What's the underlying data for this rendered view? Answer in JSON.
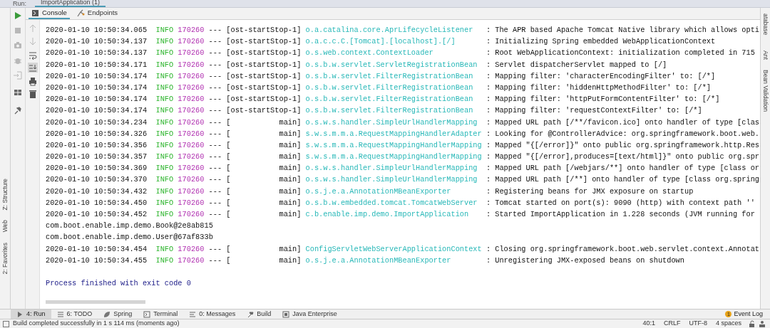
{
  "run_tab_bar": {
    "label": "Run:",
    "tab": "ImportApplication (1)"
  },
  "console_tabs": [
    {
      "label": "Console",
      "kind": "console",
      "selected": true
    },
    {
      "label": "Endpoints",
      "kind": "endpoints",
      "selected": false
    }
  ],
  "left_tool_strip": [
    {
      "label": "Z: Structure",
      "kind": "structure"
    },
    {
      "label": "Web",
      "kind": "web"
    },
    {
      "label": "2: Favorites",
      "kind": "favorites"
    }
  ],
  "right_tool_strip": [
    {
      "label": "atabase",
      "kind": "database"
    },
    {
      "label": "Ant",
      "kind": "ant"
    },
    {
      "label": "Bean Validation",
      "kind": "bean"
    }
  ],
  "log_lines": [
    {
      "kind": "log",
      "time": "2020-01-10 10:50:34.065",
      "level": "INFO",
      "pid": "170260",
      "thread": "--- [ost-startStop-1]",
      "logger": "o.a.catalina.core.AprLifecycleListener",
      "message": ": The APR based Apache Tomcat Native library which allows opti"
    },
    {
      "kind": "log",
      "time": "2020-01-10 10:50:34.137",
      "level": "INFO",
      "pid": "170260",
      "thread": "--- [ost-startStop-1]",
      "logger": "o.a.c.c.C.[Tomcat].[localhost].[/]",
      "message": ": Initializing Spring embedded WebApplicationContext"
    },
    {
      "kind": "log",
      "time": "2020-01-10 10:50:34.137",
      "level": "INFO",
      "pid": "170260",
      "thread": "--- [ost-startStop-1]",
      "logger": "o.s.web.context.ContextLoader",
      "message": ": Root WebApplicationContext: initialization completed in 715"
    },
    {
      "kind": "log",
      "time": "2020-01-10 10:50:34.171",
      "level": "INFO",
      "pid": "170260",
      "thread": "--- [ost-startStop-1]",
      "logger": "o.s.b.w.servlet.ServletRegistrationBean",
      "message": ": Servlet dispatcherServlet mapped to [/]"
    },
    {
      "kind": "log",
      "time": "2020-01-10 10:50:34.174",
      "level": "INFO",
      "pid": "170260",
      "thread": "--- [ost-startStop-1]",
      "logger": "o.s.b.w.servlet.FilterRegistrationBean",
      "message": ": Mapping filter: 'characterEncodingFilter' to: [/*]"
    },
    {
      "kind": "log",
      "time": "2020-01-10 10:50:34.174",
      "level": "INFO",
      "pid": "170260",
      "thread": "--- [ost-startStop-1]",
      "logger": "o.s.b.w.servlet.FilterRegistrationBean",
      "message": ": Mapping filter: 'hiddenHttpMethodFilter' to: [/*]"
    },
    {
      "kind": "log",
      "time": "2020-01-10 10:50:34.174",
      "level": "INFO",
      "pid": "170260",
      "thread": "--- [ost-startStop-1]",
      "logger": "o.s.b.w.servlet.FilterRegistrationBean",
      "message": ": Mapping filter: 'httpPutFormContentFilter' to: [/*]"
    },
    {
      "kind": "log",
      "time": "2020-01-10 10:50:34.174",
      "level": "INFO",
      "pid": "170260",
      "thread": "--- [ost-startStop-1]",
      "logger": "o.s.b.w.servlet.FilterRegistrationBean",
      "message": ": Mapping filter: 'requestContextFilter' to: [/*]"
    },
    {
      "kind": "log",
      "time": "2020-01-10 10:50:34.234",
      "level": "INFO",
      "pid": "170260",
      "thread": "--- [           main]",
      "logger": "o.s.w.s.handler.SimpleUrlHandlerMapping",
      "message": ": Mapped URL path [/**/favicon.ico] onto handler of type [clas"
    },
    {
      "kind": "log",
      "time": "2020-01-10 10:50:34.326",
      "level": "INFO",
      "pid": "170260",
      "thread": "--- [           main]",
      "logger": "s.w.s.m.m.a.RequestMappingHandlerAdapter",
      "message": ": Looking for @ControllerAdvice: org.springframework.boot.web."
    },
    {
      "kind": "log",
      "time": "2020-01-10 10:50:34.356",
      "level": "INFO",
      "pid": "170260",
      "thread": "--- [           main]",
      "logger": "s.w.s.m.m.a.RequestMappingHandlerMapping",
      "message": ": Mapped \"{[/error]}\" onto public org.springframework.http.Res"
    },
    {
      "kind": "log",
      "time": "2020-01-10 10:50:34.357",
      "level": "INFO",
      "pid": "170260",
      "thread": "--- [           main]",
      "logger": "s.w.s.m.m.a.RequestMappingHandlerMapping",
      "message": ": Mapped \"{[/error],produces=[text/html]}\" onto public org.spr"
    },
    {
      "kind": "log",
      "time": "2020-01-10 10:50:34.369",
      "level": "INFO",
      "pid": "170260",
      "thread": "--- [           main]",
      "logger": "o.s.w.s.handler.SimpleUrlHandlerMapping",
      "message": ": Mapped URL path [/webjars/**] onto handler of type [class or"
    },
    {
      "kind": "log",
      "time": "2020-01-10 10:50:34.370",
      "level": "INFO",
      "pid": "170260",
      "thread": "--- [           main]",
      "logger": "o.s.w.s.handler.SimpleUrlHandlerMapping",
      "message": ": Mapped URL path [/**] onto handler of type [class org.spring"
    },
    {
      "kind": "log",
      "time": "2020-01-10 10:50:34.432",
      "level": "INFO",
      "pid": "170260",
      "thread": "--- [           main]",
      "logger": "o.s.j.e.a.AnnotationMBeanExporter",
      "message": ": Registering beans for JMX exposure on startup"
    },
    {
      "kind": "log",
      "time": "2020-01-10 10:50:34.450",
      "level": "INFO",
      "pid": "170260",
      "thread": "--- [           main]",
      "logger": "o.s.b.w.embedded.tomcat.TomcatWebServer",
      "message": ": Tomcat started on port(s): 9090 (http) with context path ''"
    },
    {
      "kind": "log",
      "time": "2020-01-10 10:50:34.452",
      "level": "INFO",
      "pid": "170260",
      "thread": "--- [           main]",
      "logger": "c.b.enable.imp.demo.ImportApplication",
      "message": ": Started ImportApplication in 1.228 seconds (JVM running for"
    },
    {
      "kind": "plain",
      "text": "com.boot.enable.imp.demo.Book@2e8ab815"
    },
    {
      "kind": "plain",
      "text": "com.boot.enable.imp.demo.User@67af833b"
    },
    {
      "kind": "log",
      "time": "2020-01-10 10:50:34.454",
      "level": "INFO",
      "pid": "170260",
      "thread": "--- [           main]",
      "logger": "ConfigServletWebServerApplicationContext",
      "message": ": Closing org.springframework.boot.web.servlet.context.Annotat"
    },
    {
      "kind": "log",
      "time": "2020-01-10 10:50:34.455",
      "level": "INFO",
      "pid": "170260",
      "thread": "--- [           main]",
      "logger": "o.s.j.e.a.AnnotationMBeanExporter",
      "message": ": Unregistering JMX-exposed beans on shutdown"
    }
  ],
  "exit_message": "Process finished with exit code 0",
  "bottom_tabs": [
    {
      "label": "4: Run",
      "kind": "run",
      "selected": true
    },
    {
      "label": "6: TODO",
      "kind": "todo",
      "selected": false
    },
    {
      "label": "Spring",
      "kind": "spring",
      "selected": false
    },
    {
      "label": "Terminal",
      "kind": "terminal",
      "selected": false
    },
    {
      "label": "0: Messages",
      "kind": "messages",
      "selected": false
    },
    {
      "label": "Build",
      "kind": "build",
      "selected": false
    },
    {
      "label": "Java Enterprise",
      "kind": "javaee",
      "selected": false
    }
  ],
  "event_log": {
    "count": "1",
    "label": "Event Log"
  },
  "status_bar": {
    "message": "Build completed successfully in 1 s 114 ms (moments ago)",
    "items": [
      "40:1",
      "CRLF",
      "UTF-8",
      "4 spaces"
    ]
  }
}
